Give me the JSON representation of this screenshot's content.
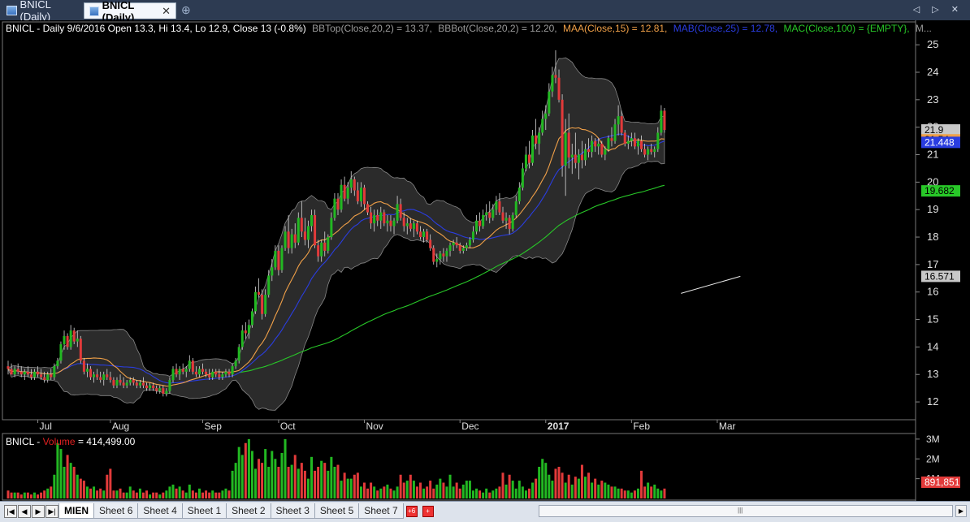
{
  "tabs": {
    "inactive_label": "BNICL (Daily)",
    "active_label": "BNICL (Daily)",
    "close_glyph": "✕",
    "new_tab_glyph": "⊕",
    "nav_glyphs": "◁ ▷ ✕"
  },
  "price_header": {
    "title": "BNICL - Daily 9/6/2016 Open 13.3, Hi 13.4, Lo 12.9, Close 13 (-0.8%)",
    "bbtop": "BBTop(Close,20,2) = 13.37,",
    "bbbot": "BBBot(Close,20,2) = 12.20,",
    "maa": "MAA(Close,15) = 12.81,",
    "mab": "MAB(Close,25) = 12.78,",
    "mac": "MAC(Close,100) = {EMPTY},",
    "more": "M..."
  },
  "volume_header": {
    "prefix": "BNICL - ",
    "volume_label": "Volume",
    "volume_value": " = 414,499.00"
  },
  "chart_data": {
    "type": "candlestick",
    "price_axis": {
      "min": 11.5,
      "max": 25.3,
      "ticks": [
        12,
        13,
        14,
        15,
        16,
        17,
        18,
        19,
        20,
        21,
        22,
        23,
        24,
        25
      ]
    },
    "time_labels": [
      "Jul",
      "Aug",
      "Sep",
      "Oct",
      "Nov",
      "Dec",
      "2017",
      "Feb",
      "Mar"
    ],
    "time_label_index": [
      9,
      31,
      59,
      82,
      108,
      137,
      163,
      189,
      215
    ],
    "bars": [
      [
        13.3,
        13.5,
        13.0,
        13.2
      ],
      [
        13.2,
        13.4,
        13.0,
        13.0
      ],
      [
        13.0,
        13.3,
        12.9,
        13.2
      ],
      [
        13.2,
        13.4,
        13.0,
        13.1
      ],
      [
        13.1,
        13.3,
        12.9,
        13.0
      ],
      [
        13.0,
        13.2,
        12.8,
        13.1
      ],
      [
        13.1,
        13.3,
        12.9,
        13.0
      ],
      [
        13.0,
        13.2,
        12.8,
        12.9
      ],
      [
        12.9,
        13.2,
        12.8,
        13.1
      ],
      [
        13.1,
        13.3,
        12.9,
        13.0
      ],
      [
        13.0,
        13.2,
        12.8,
        12.9
      ],
      [
        12.9,
        13.1,
        12.7,
        12.8
      ],
      [
        12.8,
        13.1,
        12.7,
        13.0
      ],
      [
        13.0,
        13.2,
        12.8,
        12.9
      ],
      [
        12.9,
        13.4,
        12.8,
        13.3
      ],
      [
        13.3,
        13.6,
        13.2,
        13.5
      ],
      [
        13.5,
        14.2,
        13.4,
        14.1
      ],
      [
        14.1,
        14.6,
        13.9,
        14.4
      ],
      [
        14.4,
        14.5,
        13.9,
        14.0
      ],
      [
        14.0,
        14.8,
        13.9,
        14.6
      ],
      [
        14.6,
        14.7,
        14.1,
        14.2
      ],
      [
        14.2,
        14.6,
        14.0,
        14.3
      ],
      [
        14.3,
        14.4,
        13.4,
        13.5
      ],
      [
        13.5,
        13.6,
        13.0,
        13.1
      ],
      [
        13.1,
        13.4,
        12.9,
        13.2
      ],
      [
        13.2,
        13.3,
        12.8,
        12.9
      ],
      [
        12.9,
        13.1,
        12.7,
        13.0
      ],
      [
        13.0,
        13.2,
        12.8,
        12.9
      ],
      [
        12.9,
        13.1,
        12.7,
        12.8
      ],
      [
        12.8,
        13.1,
        12.6,
        13.0
      ],
      [
        13.0,
        13.2,
        12.8,
        12.9
      ],
      [
        12.9,
        13.1,
        12.7,
        12.8
      ],
      [
        12.8,
        12.9,
        12.5,
        12.6
      ],
      [
        12.6,
        12.9,
        12.5,
        12.8
      ],
      [
        12.8,
        13.0,
        12.6,
        12.7
      ],
      [
        12.7,
        12.9,
        12.5,
        12.6
      ],
      [
        12.6,
        12.8,
        12.5,
        12.7
      ],
      [
        12.7,
        12.9,
        12.6,
        12.8
      ],
      [
        12.8,
        12.9,
        12.6,
        12.7
      ],
      [
        12.7,
        12.8,
        12.5,
        12.6
      ],
      [
        12.6,
        12.8,
        12.5,
        12.7
      ],
      [
        12.7,
        12.9,
        12.5,
        12.6
      ],
      [
        12.6,
        12.7,
        12.4,
        12.5
      ],
      [
        12.5,
        12.7,
        12.4,
        12.6
      ],
      [
        12.6,
        12.7,
        12.4,
        12.5
      ],
      [
        12.5,
        12.6,
        12.3,
        12.4
      ],
      [
        12.4,
        12.6,
        12.3,
        12.5
      ],
      [
        12.5,
        12.6,
        12.2,
        12.3
      ],
      [
        12.3,
        12.5,
        12.2,
        12.4
      ],
      [
        12.4,
        12.9,
        12.3,
        12.8
      ],
      [
        12.8,
        13.3,
        12.7,
        13.2
      ],
      [
        13.2,
        13.4,
        12.9,
        13.0
      ],
      [
        13.0,
        13.3,
        12.8,
        13.2
      ],
      [
        13.2,
        13.4,
        13.0,
        13.1
      ],
      [
        13.1,
        13.3,
        12.9,
        13.2
      ],
      [
        13.2,
        13.7,
        13.1,
        13.5
      ],
      [
        13.5,
        13.6,
        13.0,
        13.1
      ],
      [
        13.1,
        13.3,
        12.9,
        13.0
      ],
      [
        13.0,
        13.3,
        12.9,
        13.2
      ],
      [
        13.2,
        13.4,
        13.0,
        13.1
      ],
      [
        13.1,
        13.2,
        12.9,
        13.0
      ],
      [
        13.0,
        13.2,
        12.8,
        12.9
      ],
      [
        12.9,
        13.2,
        12.8,
        13.1
      ],
      [
        13.1,
        13.2,
        12.9,
        13.0
      ],
      [
        13.0,
        13.2,
        12.8,
        12.9
      ],
      [
        12.9,
        13.1,
        12.8,
        13.0
      ],
      [
        13.0,
        13.2,
        12.9,
        13.1
      ],
      [
        13.1,
        13.2,
        12.9,
        13.0
      ],
      [
        13.0,
        13.4,
        12.9,
        13.3
      ],
      [
        13.3,
        13.6,
        13.2,
        13.5
      ],
      [
        13.5,
        14.1,
        13.4,
        14.0
      ],
      [
        14.0,
        14.8,
        13.9,
        14.6
      ],
      [
        14.6,
        14.9,
        14.3,
        14.5
      ],
      [
        14.5,
        15.0,
        14.3,
        14.8
      ],
      [
        14.8,
        15.4,
        14.7,
        15.3
      ],
      [
        15.3,
        16.2,
        15.2,
        16.0
      ],
      [
        16.0,
        16.5,
        15.8,
        15.9
      ],
      [
        15.9,
        16.1,
        15.0,
        15.2
      ],
      [
        15.2,
        16.1,
        15.1,
        15.9
      ],
      [
        15.9,
        16.8,
        15.8,
        16.6
      ],
      [
        16.6,
        17.2,
        16.4,
        16.9
      ],
      [
        16.9,
        17.7,
        16.8,
        17.5
      ],
      [
        17.5,
        17.7,
        16.6,
        16.8
      ],
      [
        16.8,
        17.7,
        16.7,
        17.6
      ],
      [
        17.6,
        18.4,
        17.5,
        18.2
      ],
      [
        18.2,
        18.8,
        17.4,
        17.6
      ],
      [
        17.6,
        18.3,
        17.4,
        18.1
      ],
      [
        18.1,
        18.5,
        17.6,
        17.8
      ],
      [
        17.8,
        18.9,
        17.7,
        18.7
      ],
      [
        18.7,
        19.3,
        18.0,
        18.2
      ],
      [
        18.2,
        18.7,
        17.7,
        17.9
      ],
      [
        17.9,
        18.6,
        17.6,
        18.4
      ],
      [
        18.4,
        19.0,
        18.2,
        18.8
      ],
      [
        18.8,
        19.0,
        17.6,
        17.7
      ],
      [
        17.7,
        17.9,
        17.1,
        17.3
      ],
      [
        17.3,
        17.9,
        17.1,
        17.8
      ],
      [
        17.8,
        18.2,
        17.3,
        17.5
      ],
      [
        17.5,
        18.1,
        17.4,
        18.0
      ],
      [
        18.0,
        18.9,
        17.9,
        18.7
      ],
      [
        18.7,
        19.6,
        18.6,
        19.4
      ],
      [
        19.4,
        19.6,
        18.8,
        19.0
      ],
      [
        19.0,
        20.1,
        18.9,
        19.9
      ],
      [
        19.9,
        20.2,
        19.3,
        19.4
      ],
      [
        19.4,
        20.0,
        19.2,
        19.8
      ],
      [
        19.8,
        20.4,
        19.6,
        20.1
      ],
      [
        20.1,
        20.2,
        19.5,
        19.7
      ],
      [
        19.7,
        20.0,
        19.2,
        19.3
      ],
      [
        19.3,
        20.0,
        19.1,
        19.8
      ],
      [
        19.8,
        19.9,
        19.0,
        19.2
      ],
      [
        19.2,
        19.3,
        18.8,
        18.9
      ],
      [
        18.9,
        19.1,
        18.3,
        18.5
      ],
      [
        18.5,
        19.0,
        18.2,
        18.8
      ],
      [
        18.8,
        19.0,
        18.4,
        18.6
      ],
      [
        18.6,
        19.1,
        18.3,
        18.9
      ],
      [
        18.9,
        19.0,
        18.4,
        18.5
      ],
      [
        18.5,
        18.8,
        18.2,
        18.6
      ],
      [
        18.6,
        18.8,
        18.2,
        18.4
      ],
      [
        18.4,
        18.7,
        18.1,
        18.6
      ],
      [
        18.6,
        19.5,
        18.5,
        19.2
      ],
      [
        19.2,
        19.4,
        18.6,
        18.7
      ],
      [
        18.7,
        18.9,
        18.2,
        18.4
      ],
      [
        18.4,
        18.7,
        18.1,
        18.5
      ],
      [
        18.5,
        18.7,
        18.2,
        18.3
      ],
      [
        18.3,
        18.6,
        18.0,
        18.5
      ],
      [
        18.5,
        18.6,
        18.1,
        18.2
      ],
      [
        18.2,
        18.4,
        17.9,
        18.0
      ],
      [
        18.0,
        18.3,
        17.8,
        18.2
      ],
      [
        18.2,
        18.3,
        17.8,
        17.9
      ],
      [
        17.9,
        18.1,
        17.5,
        17.6
      ],
      [
        17.6,
        17.7,
        17.0,
        17.1
      ],
      [
        17.1,
        17.4,
        16.9,
        17.2
      ],
      [
        17.2,
        17.5,
        17.0,
        17.4
      ],
      [
        17.4,
        17.6,
        17.1,
        17.3
      ],
      [
        17.3,
        17.6,
        17.1,
        17.5
      ],
      [
        17.5,
        17.8,
        17.3,
        17.7
      ],
      [
        17.7,
        17.9,
        17.5,
        17.8
      ],
      [
        17.8,
        18.0,
        17.6,
        17.7
      ],
      [
        17.7,
        17.8,
        17.4,
        17.5
      ],
      [
        17.5,
        17.7,
        17.4,
        17.6
      ],
      [
        17.6,
        17.8,
        17.5,
        17.7
      ],
      [
        17.7,
        18.0,
        17.6,
        17.9
      ],
      [
        17.9,
        18.4,
        17.8,
        18.2
      ],
      [
        18.2,
        18.8,
        18.1,
        18.6
      ],
      [
        18.6,
        18.9,
        18.2,
        18.4
      ],
      [
        18.4,
        19.0,
        18.3,
        18.8
      ],
      [
        18.8,
        19.2,
        18.6,
        18.9
      ],
      [
        18.9,
        19.3,
        18.5,
        18.7
      ],
      [
        18.7,
        19.2,
        18.6,
        19.0
      ],
      [
        19.0,
        19.5,
        18.8,
        19.3
      ],
      [
        19.3,
        19.6,
        18.8,
        18.9
      ],
      [
        18.9,
        19.1,
        18.5,
        18.6
      ],
      [
        18.6,
        18.9,
        18.3,
        18.7
      ],
      [
        18.7,
        18.8,
        18.1,
        18.3
      ],
      [
        18.3,
        18.9,
        18.2,
        18.8
      ],
      [
        18.8,
        19.5,
        18.7,
        19.3
      ],
      [
        19.3,
        20.0,
        19.2,
        19.8
      ],
      [
        19.8,
        20.7,
        19.7,
        20.5
      ],
      [
        20.5,
        21.3,
        20.4,
        21.0
      ],
      [
        21.0,
        21.5,
        20.5,
        20.7
      ],
      [
        20.7,
        21.9,
        20.6,
        21.7
      ],
      [
        21.7,
        22.3,
        21.2,
        21.4
      ],
      [
        21.4,
        22.0,
        21.0,
        21.8
      ],
      [
        21.8,
        22.6,
        21.7,
        22.3
      ],
      [
        22.3,
        22.8,
        21.9,
        22.5
      ],
      [
        22.5,
        23.6,
        22.4,
        23.3
      ],
      [
        23.3,
        24.2,
        23.1,
        23.9
      ],
      [
        23.9,
        24.8,
        23.6,
        23.8
      ],
      [
        23.8,
        24.1,
        22.9,
        23.0
      ],
      [
        23.0,
        23.2,
        20.2,
        20.6
      ],
      [
        20.6,
        22.3,
        19.5,
        21.8
      ],
      [
        21.8,
        22.5,
        20.5,
        20.9
      ],
      [
        20.9,
        21.4,
        20.3,
        21.0
      ],
      [
        21.0,
        21.8,
        20.5,
        20.7
      ],
      [
        20.7,
        21.2,
        20.1,
        21.0
      ],
      [
        21.0,
        21.5,
        20.5,
        20.8
      ],
      [
        20.8,
        21.4,
        20.6,
        21.2
      ],
      [
        21.2,
        21.6,
        20.9,
        21.1
      ],
      [
        21.1,
        21.7,
        20.9,
        21.5
      ],
      [
        21.5,
        21.6,
        21.1,
        21.3
      ],
      [
        21.3,
        21.6,
        21.0,
        21.4
      ],
      [
        21.4,
        21.5,
        20.9,
        21.0
      ],
      [
        21.0,
        21.3,
        20.8,
        21.2
      ],
      [
        21.2,
        21.7,
        21.1,
        21.6
      ],
      [
        21.6,
        22.0,
        21.3,
        21.5
      ],
      [
        21.5,
        22.3,
        21.4,
        22.1
      ],
      [
        22.1,
        22.8,
        21.7,
        22.4
      ],
      [
        22.4,
        22.6,
        21.7,
        21.8
      ],
      [
        21.8,
        21.9,
        21.3,
        21.4
      ],
      [
        21.4,
        21.7,
        21.2,
        21.5
      ],
      [
        21.5,
        21.8,
        21.3,
        21.6
      ],
      [
        21.6,
        21.8,
        21.2,
        21.3
      ],
      [
        21.3,
        21.6,
        21.0,
        21.5
      ],
      [
        21.5,
        21.7,
        21.1,
        21.2
      ],
      [
        21.2,
        21.4,
        20.9,
        21.0
      ],
      [
        21.0,
        21.3,
        20.8,
        21.2
      ],
      [
        21.2,
        21.4,
        21.0,
        21.1
      ],
      [
        21.1,
        21.3,
        20.9,
        21.2
      ],
      [
        21.2,
        22.0,
        21.1,
        21.8
      ],
      [
        21.8,
        22.8,
        21.7,
        22.6
      ],
      [
        22.6,
        22.7,
        21.8,
        21.9
      ]
    ],
    "moving_averages": {
      "maa": {
        "label": "MAA(Close,15)",
        "value": 21.54,
        "color": "#f0a048"
      },
      "mab": {
        "label": "MAB(Close,25)",
        "value": 21.448,
        "color": "#2a3de0"
      },
      "mac": {
        "label": "MAC(Close,100)",
        "value": 19.682,
        "color": "#28c828"
      },
      "extra": {
        "value": 16.571,
        "color": "#e8e8e8"
      }
    },
    "bollinger": {
      "period": 20,
      "stdev": 2
    },
    "last_close": 21.9,
    "volume_axis": {
      "min": 0,
      "max": 3200000,
      "ticks": [
        "1M",
        "2M",
        "3M"
      ],
      "tick_values": [
        1000000,
        2000000,
        3000000
      ]
    },
    "volume_last": "891,851",
    "volumes": [
      0.4,
      0.3,
      0.3,
      0.3,
      0.2,
      0.3,
      0.3,
      0.2,
      0.3,
      0.2,
      0.3,
      0.4,
      0.5,
      0.6,
      1.2,
      2.8,
      2.5,
      1.6,
      2.2,
      1.8,
      1.6,
      1.2,
      1.0,
      0.9,
      0.6,
      0.5,
      0.6,
      0.4,
      0.5,
      0.4,
      1.2,
      1.5,
      0.4,
      0.4,
      0.5,
      0.3,
      0.3,
      0.6,
      0.4,
      0.3,
      0.5,
      0.3,
      0.4,
      0.2,
      0.3,
      0.3,
      0.2,
      0.3,
      0.4,
      0.6,
      0.7,
      0.5,
      0.6,
      0.4,
      0.3,
      0.7,
      0.4,
      0.3,
      0.5,
      0.3,
      0.4,
      0.3,
      0.4,
      0.3,
      0.3,
      0.4,
      0.5,
      0.4,
      1.4,
      1.8,
      2.6,
      2.2,
      2.8,
      3.0,
      2.4,
      1.5,
      2.0,
      1.8,
      2.5,
      1.6,
      2.4,
      2.0,
      1.6,
      2.3,
      3.0,
      1.6,
      1.7,
      2.2,
      1.5,
      1.8,
      1.4,
      1.0,
      2.1,
      1.4,
      1.6,
      1.9,
      1.8,
      1.4,
      2.1,
      1.6,
      1.7,
      0.9,
      1.3,
      1.0,
      1.0,
      1.2,
      1.3,
      0.6,
      0.8,
      0.5,
      0.8,
      0.6,
      0.4,
      0.5,
      0.6,
      0.7,
      0.5,
      0.4,
      0.6,
      1.2,
      0.8,
      0.9,
      1.2,
      0.9,
      0.6,
      0.8,
      0.5,
      0.6,
      0.9,
      0.5,
      0.7,
      1.0,
      0.8,
      0.6,
      1.2,
      0.6,
      0.8,
      0.5,
      0.7,
      0.9,
      0.9,
      0.4,
      0.5,
      0.4,
      0.3,
      0.5,
      0.3,
      0.4,
      0.5,
      0.6,
      1.3,
      0.7,
      1.2,
      0.9,
      0.5,
      0.9,
      0.6,
      0.4,
      0.5,
      0.8,
      1.0,
      1.6,
      2.0,
      1.8,
      1.2,
      0.9,
      1.5,
      1.6,
      1.3,
      0.8,
      1.2,
      0.7,
      1.1,
      1.0,
      1.7,
      1.1,
      1.3,
      0.8,
      1.0,
      0.7,
      0.9,
      0.8,
      0.7,
      0.6,
      0.6,
      0.5,
      0.5,
      0.4,
      0.4,
      0.3,
      0.4,
      0.5,
      1.4,
      0.6,
      0.8,
      0.6,
      0.7,
      0.5,
      0.4,
      0.5,
      0.4,
      0.3,
      0.5,
      0.4,
      0.3,
      0.4,
      0.3,
      0.3,
      0.4,
      0.3,
      0.4,
      0.3,
      0.3,
      0.4,
      0.3,
      0.4,
      0.3,
      0.4,
      1.0,
      0.9
    ]
  },
  "value_labels": {
    "last": "21.9",
    "maa": "21.54",
    "mab": "21.448",
    "mac": "19.682",
    "extra": "16.571",
    "volume": "891,851"
  },
  "sheets": {
    "active": "MIEN",
    "others": [
      "Sheet 6",
      "Sheet 4",
      "Sheet 1",
      "Sheet 2",
      "Sheet 3",
      "Sheet 5",
      "Sheet 7"
    ],
    "nav": [
      "|◀",
      "◀",
      "▶",
      "▶|"
    ],
    "lock_buttons": [
      "+6",
      "+"
    ]
  },
  "colors": {
    "up": "#22b822",
    "down": "#e23a3a",
    "band_fill": "#2b2b2b",
    "frame": "#777777",
    "volume_label": "#e02020"
  }
}
